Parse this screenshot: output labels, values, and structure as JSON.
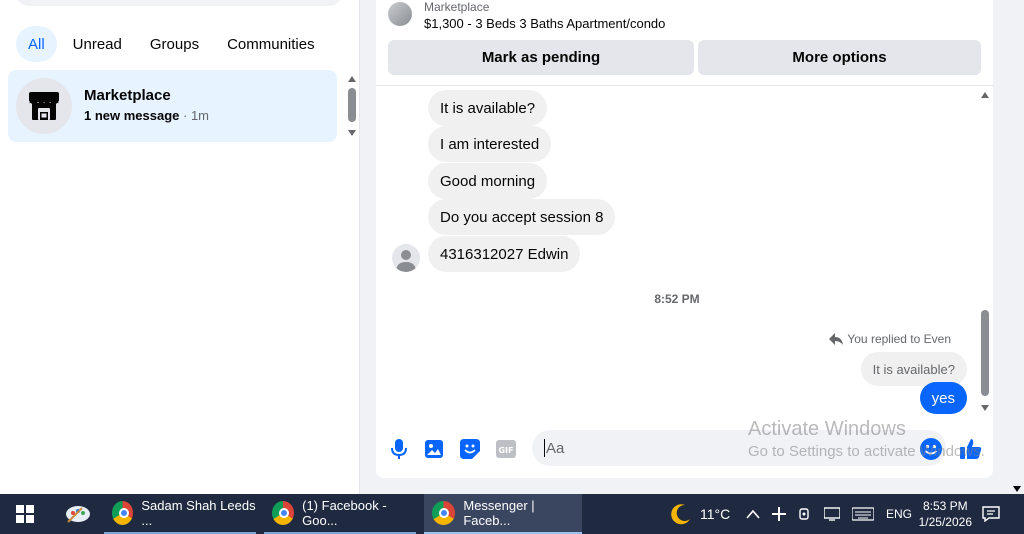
{
  "sidebar": {
    "filters": [
      "All",
      "Unread",
      "Groups",
      "Communities"
    ],
    "conversation": {
      "name": "Marketplace",
      "unread_text": "1 new message",
      "time": " · 1m"
    }
  },
  "chat": {
    "header": {
      "label": "Marketplace",
      "title": "$1,300 - 3 Beds 3 Baths Apartment/condo",
      "pending_button": "Mark as pending",
      "more_button": "More options"
    },
    "messages": [
      "It is available?",
      "I am interested",
      "Good morning",
      "Do you accept session 8",
      "4316312027 Edwin"
    ],
    "timestamp": "8:52 PM",
    "replied_text": "You replied to Even",
    "reply_quote": "It is available?",
    "my_message": "yes",
    "composer_placeholder": "Aa"
  },
  "watermark": {
    "line1": "Activate Windows",
    "line2": "Go to Settings to activate Windows."
  },
  "taskbar": {
    "apps": [
      "Sadam Shah Leeds ...",
      "(1) Facebook - Goo...",
      "Messenger | Faceb..."
    ],
    "temperature": "11°C",
    "language": "ENG",
    "time": "8:53 PM",
    "date": "1/25/2026"
  },
  "colors": {
    "accent": "#0866ff",
    "active_filter_bg": "#e7f3ff",
    "taskbar": "#1f2a40"
  }
}
